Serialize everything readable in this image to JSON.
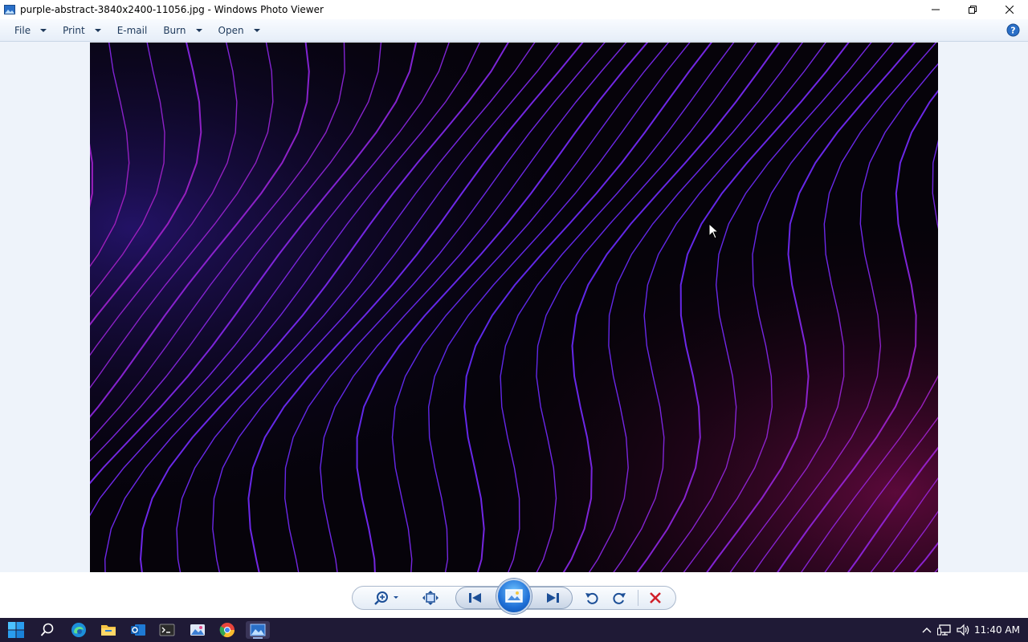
{
  "window": {
    "title": "purple-abstract-3840x2400-11056.jpg - Windows Photo Viewer"
  },
  "menu": {
    "items": [
      {
        "label": "File",
        "has_dropdown": true
      },
      {
        "label": "Print",
        "has_dropdown": true
      },
      {
        "label": "E-mail",
        "has_dropdown": false
      },
      {
        "label": "Burn",
        "has_dropdown": true
      },
      {
        "label": "Open",
        "has_dropdown": true
      }
    ],
    "help_icon": "help-icon"
  },
  "controls": {
    "icons": [
      "zoom-icon",
      "fit-to-window-icon",
      "previous-icon",
      "slideshow-icon",
      "next-icon",
      "rotate-counterclockwise-icon",
      "rotate-clockwise-icon",
      "delete-icon"
    ]
  },
  "taskbar": {
    "icons": [
      "windows-start-icon",
      "search-icon",
      "edge-icon",
      "file-explorer-icon",
      "outlook-icon",
      "terminal-icon",
      "photos-icon",
      "chrome-icon",
      "photo-viewer-icon"
    ],
    "active": "photo-viewer-icon",
    "clock": "11:40 AM"
  },
  "colors": {
    "accent": "#1f6fd6",
    "delete": "#d0202a",
    "taskbar": "#1f1a36"
  }
}
